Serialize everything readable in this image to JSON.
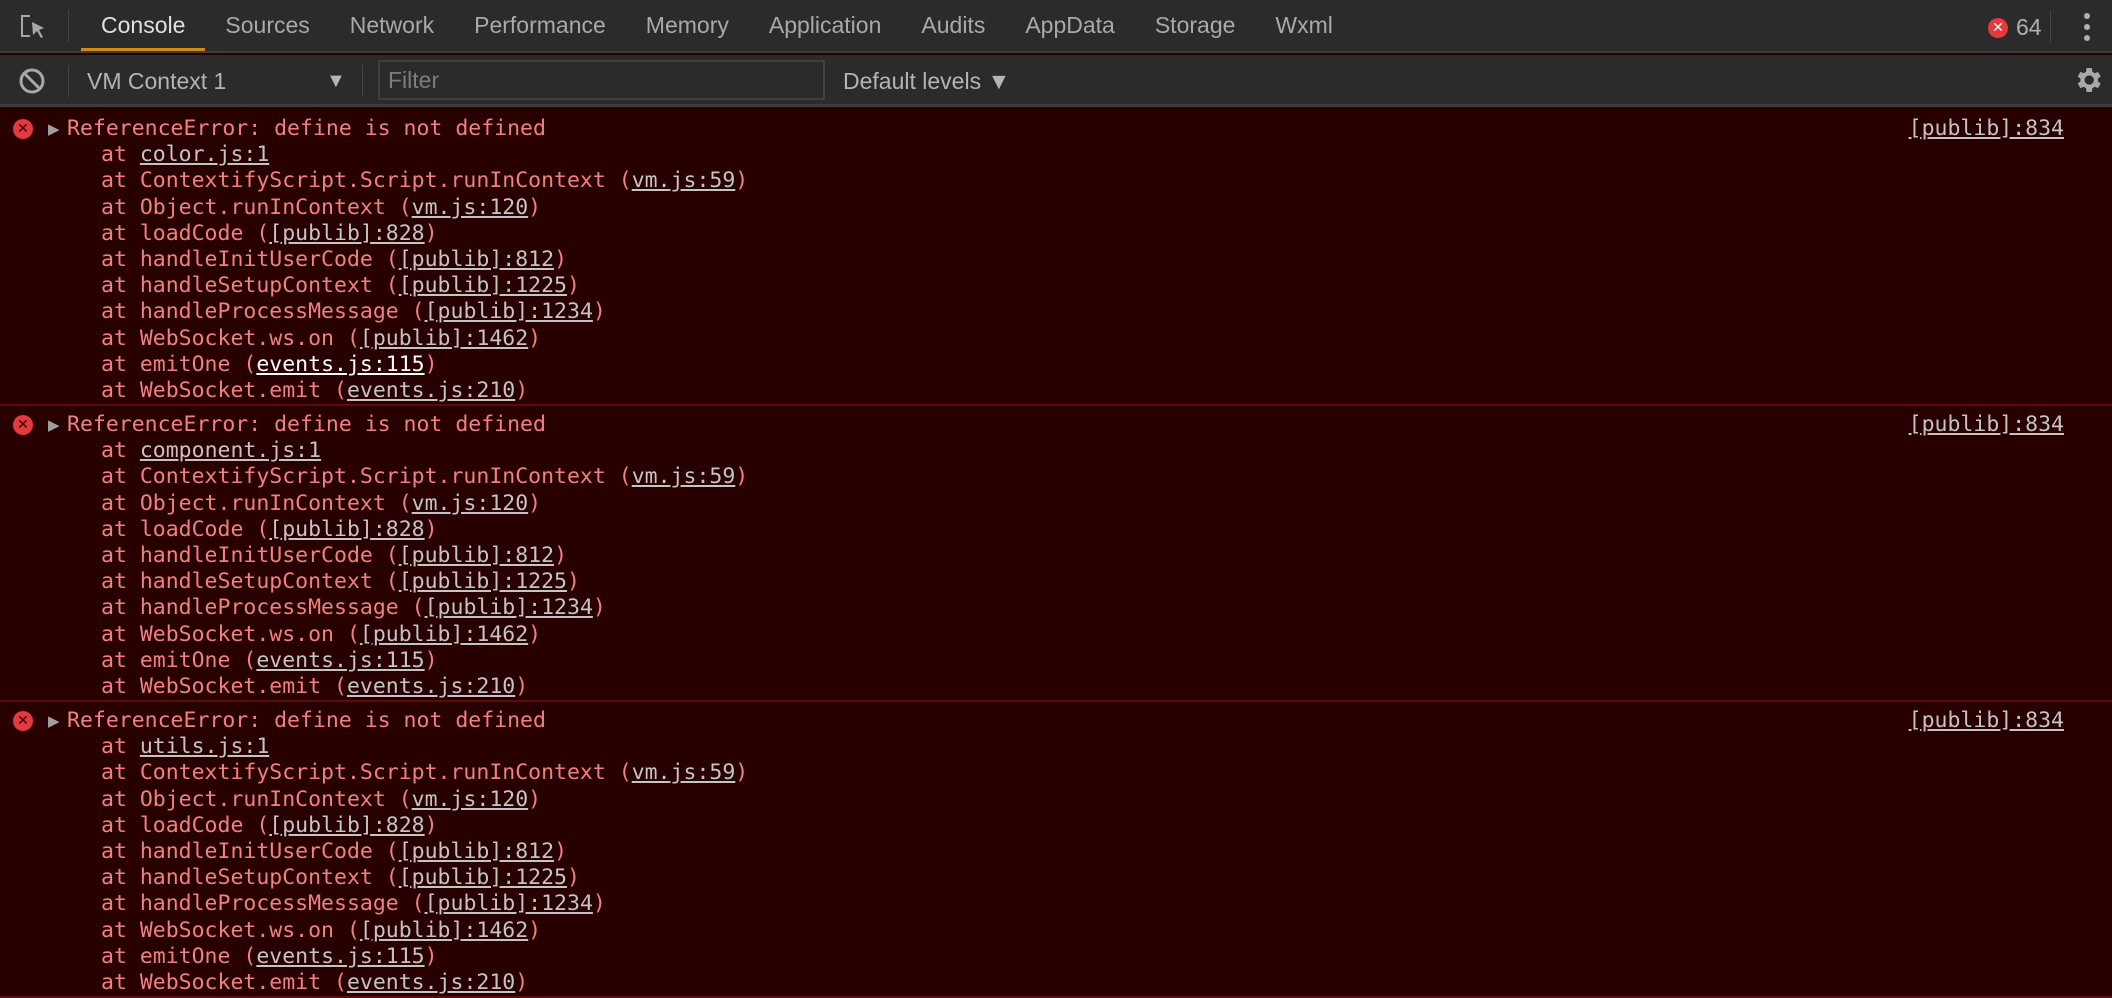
{
  "tabs": [
    "Console",
    "Sources",
    "Network",
    "Performance",
    "Memory",
    "Application",
    "Audits",
    "AppData",
    "Storage",
    "Wxml"
  ],
  "active_tab": "Console",
  "error_count": "64",
  "toolbar": {
    "context": "VM Context 1",
    "filter_placeholder": "Filter",
    "filter_value": "",
    "levels": "Default levels ▼",
    "context_arrow": "▼"
  },
  "colors": {
    "accent": "#d38a14",
    "error": "#e4393d",
    "error_text": "#f18080",
    "console_bg": "#280000"
  },
  "entries": [
    {
      "message": "ReferenceError: define is not defined",
      "source": "[publib]:834",
      "stack": [
        {
          "pre": "at ",
          "link": "color.js:1",
          "post": ""
        },
        {
          "pre": "at ContextifyScript.Script.runInContext (",
          "link": "vm.js:59",
          "post": ")"
        },
        {
          "pre": "at Object.runInContext (",
          "link": "vm.js:120",
          "post": ")"
        },
        {
          "pre": "at loadCode (",
          "link": "[publib]:828",
          "post": ")"
        },
        {
          "pre": "at handleInitUserCode (",
          "link": "[publib]:812",
          "post": ")"
        },
        {
          "pre": "at handleSetupContext (",
          "link": "[publib]:1225",
          "post": ")"
        },
        {
          "pre": "at handleProcessMessage (",
          "link": "[publib]:1234",
          "post": ")"
        },
        {
          "pre": "at WebSocket.ws.on (",
          "link": "[publib]:1462",
          "post": ")"
        },
        {
          "pre": "at emitOne (",
          "link": "events.js:115",
          "post": ")",
          "hover": true
        },
        {
          "pre": "at WebSocket.emit (",
          "link": "events.js:210",
          "post": ")"
        }
      ]
    },
    {
      "message": "ReferenceError: define is not defined",
      "source": "[publib]:834",
      "stack": [
        {
          "pre": "at ",
          "link": "component.js:1",
          "post": ""
        },
        {
          "pre": "at ContextifyScript.Script.runInContext (",
          "link": "vm.js:59",
          "post": ")"
        },
        {
          "pre": "at Object.runInContext (",
          "link": "vm.js:120",
          "post": ")"
        },
        {
          "pre": "at loadCode (",
          "link": "[publib]:828",
          "post": ")"
        },
        {
          "pre": "at handleInitUserCode (",
          "link": "[publib]:812",
          "post": ")"
        },
        {
          "pre": "at handleSetupContext (",
          "link": "[publib]:1225",
          "post": ")"
        },
        {
          "pre": "at handleProcessMessage (",
          "link": "[publib]:1234",
          "post": ")"
        },
        {
          "pre": "at WebSocket.ws.on (",
          "link": "[publib]:1462",
          "post": ")"
        },
        {
          "pre": "at emitOne (",
          "link": "events.js:115",
          "post": ")"
        },
        {
          "pre": "at WebSocket.emit (",
          "link": "events.js:210",
          "post": ")"
        }
      ]
    },
    {
      "message": "ReferenceError: define is not defined",
      "source": "[publib]:834",
      "stack": [
        {
          "pre": "at ",
          "link": "utils.js:1",
          "post": ""
        },
        {
          "pre": "at ContextifyScript.Script.runInContext (",
          "link": "vm.js:59",
          "post": ")"
        },
        {
          "pre": "at Object.runInContext (",
          "link": "vm.js:120",
          "post": ")"
        },
        {
          "pre": "at loadCode (",
          "link": "[publib]:828",
          "post": ")"
        },
        {
          "pre": "at handleInitUserCode (",
          "link": "[publib]:812",
          "post": ")"
        },
        {
          "pre": "at handleSetupContext (",
          "link": "[publib]:1225",
          "post": ")"
        },
        {
          "pre": "at handleProcessMessage (",
          "link": "[publib]:1234",
          "post": ")"
        },
        {
          "pre": "at WebSocket.ws.on (",
          "link": "[publib]:1462",
          "post": ")"
        },
        {
          "pre": "at emitOne (",
          "link": "events.js:115",
          "post": ")"
        },
        {
          "pre": "at WebSocket.emit (",
          "link": "events.js:210",
          "post": ")"
        }
      ]
    }
  ]
}
